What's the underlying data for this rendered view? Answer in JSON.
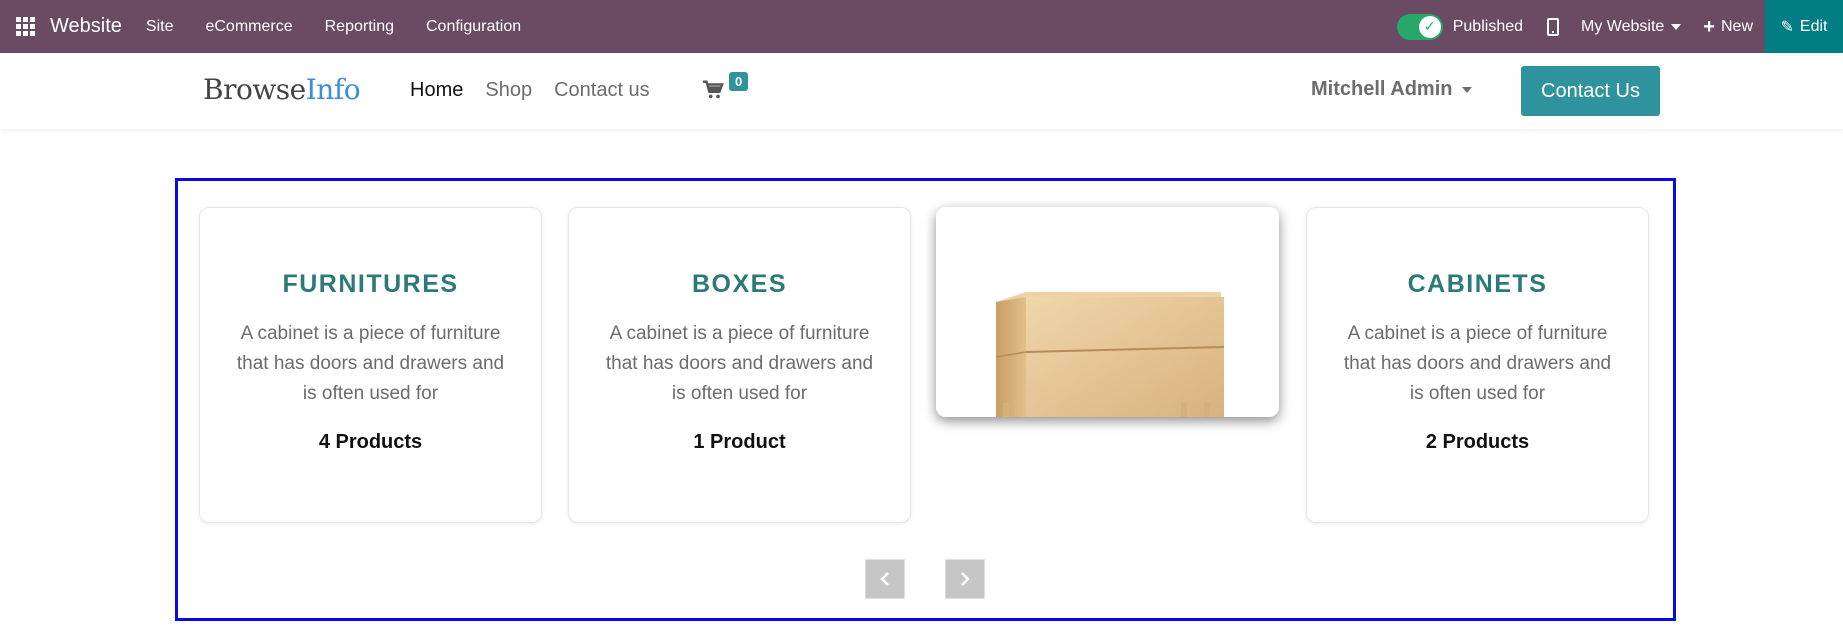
{
  "admin_bar": {
    "app_name": "Website",
    "menus": [
      "Site",
      "eCommerce",
      "Reporting",
      "Configuration"
    ],
    "published_label": "Published",
    "website_select": "My Website",
    "new_label": "New",
    "edit_label": "Edit",
    "bar_color": "#6b4a63",
    "edit_color": "#017e84",
    "toggle_color": "#28a76b"
  },
  "header": {
    "logo_part1": "Browse",
    "logo_part2": "Info",
    "nav": [
      "Home",
      "Shop",
      "Contact us"
    ],
    "active_nav": "Home",
    "cart_count": "0",
    "user_name": "Mitchell Admin",
    "contact_button": "Contact Us",
    "accent_color": "#2f939d"
  },
  "carousel": {
    "cards": [
      {
        "title": "FURNITURES",
        "description": "A cabinet is a piece of furniture that has doors and drawers and is often used for",
        "count": "4 Products"
      },
      {
        "title": "BOXES",
        "description": "A cabinet is a piece of furniture that has doors and drawers and is often used for",
        "count": "1 Product"
      },
      {
        "title": "CABINETS",
        "description": "A cabinet is a piece of furniture that has doors and drawers and is often used for",
        "count": "2 Products"
      }
    ],
    "image_card": "drawer-cabinet-image",
    "prev_icon": "chevron-left-icon",
    "next_icon": "chevron-right-icon",
    "border_color": "#0a0ae8",
    "title_color": "#2c7a78"
  }
}
